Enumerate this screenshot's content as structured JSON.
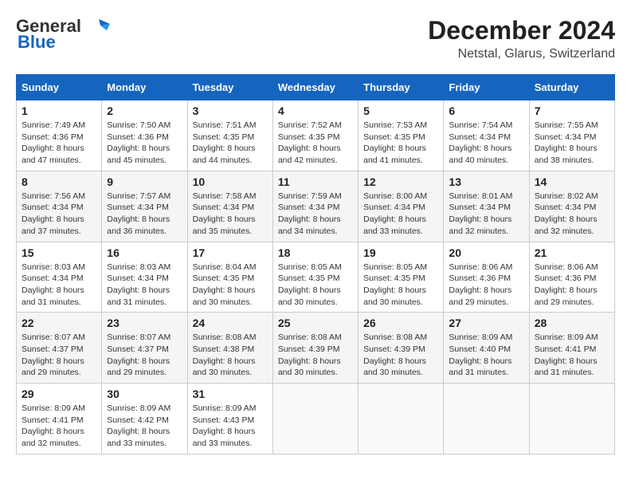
{
  "logo": {
    "line1": "General",
    "line2": "Blue"
  },
  "title": "December 2024",
  "subtitle": "Netstal, Glarus, Switzerland",
  "days_of_week": [
    "Sunday",
    "Monday",
    "Tuesday",
    "Wednesday",
    "Thursday",
    "Friday",
    "Saturday"
  ],
  "weeks": [
    [
      {
        "day": "1",
        "sunrise": "7:49 AM",
        "sunset": "4:36 PM",
        "daylight": "8 hours and 47 minutes."
      },
      {
        "day": "2",
        "sunrise": "7:50 AM",
        "sunset": "4:36 PM",
        "daylight": "8 hours and 45 minutes."
      },
      {
        "day": "3",
        "sunrise": "7:51 AM",
        "sunset": "4:35 PM",
        "daylight": "8 hours and 44 minutes."
      },
      {
        "day": "4",
        "sunrise": "7:52 AM",
        "sunset": "4:35 PM",
        "daylight": "8 hours and 42 minutes."
      },
      {
        "day": "5",
        "sunrise": "7:53 AM",
        "sunset": "4:35 PM",
        "daylight": "8 hours and 41 minutes."
      },
      {
        "day": "6",
        "sunrise": "7:54 AM",
        "sunset": "4:34 PM",
        "daylight": "8 hours and 40 minutes."
      },
      {
        "day": "7",
        "sunrise": "7:55 AM",
        "sunset": "4:34 PM",
        "daylight": "8 hours and 38 minutes."
      }
    ],
    [
      {
        "day": "8",
        "sunrise": "7:56 AM",
        "sunset": "4:34 PM",
        "daylight": "8 hours and 37 minutes."
      },
      {
        "day": "9",
        "sunrise": "7:57 AM",
        "sunset": "4:34 PM",
        "daylight": "8 hours and 36 minutes."
      },
      {
        "day": "10",
        "sunrise": "7:58 AM",
        "sunset": "4:34 PM",
        "daylight": "8 hours and 35 minutes."
      },
      {
        "day": "11",
        "sunrise": "7:59 AM",
        "sunset": "4:34 PM",
        "daylight": "8 hours and 34 minutes."
      },
      {
        "day": "12",
        "sunrise": "8:00 AM",
        "sunset": "4:34 PM",
        "daylight": "8 hours and 33 minutes."
      },
      {
        "day": "13",
        "sunrise": "8:01 AM",
        "sunset": "4:34 PM",
        "daylight": "8 hours and 32 minutes."
      },
      {
        "day": "14",
        "sunrise": "8:02 AM",
        "sunset": "4:34 PM",
        "daylight": "8 hours and 32 minutes."
      }
    ],
    [
      {
        "day": "15",
        "sunrise": "8:03 AM",
        "sunset": "4:34 PM",
        "daylight": "8 hours and 31 minutes."
      },
      {
        "day": "16",
        "sunrise": "8:03 AM",
        "sunset": "4:34 PM",
        "daylight": "8 hours and 31 minutes."
      },
      {
        "day": "17",
        "sunrise": "8:04 AM",
        "sunset": "4:35 PM",
        "daylight": "8 hours and 30 minutes."
      },
      {
        "day": "18",
        "sunrise": "8:05 AM",
        "sunset": "4:35 PM",
        "daylight": "8 hours and 30 minutes."
      },
      {
        "day": "19",
        "sunrise": "8:05 AM",
        "sunset": "4:35 PM",
        "daylight": "8 hours and 30 minutes."
      },
      {
        "day": "20",
        "sunrise": "8:06 AM",
        "sunset": "4:36 PM",
        "daylight": "8 hours and 29 minutes."
      },
      {
        "day": "21",
        "sunrise": "8:06 AM",
        "sunset": "4:36 PM",
        "daylight": "8 hours and 29 minutes."
      }
    ],
    [
      {
        "day": "22",
        "sunrise": "8:07 AM",
        "sunset": "4:37 PM",
        "daylight": "8 hours and 29 minutes."
      },
      {
        "day": "23",
        "sunrise": "8:07 AM",
        "sunset": "4:37 PM",
        "daylight": "8 hours and 29 minutes."
      },
      {
        "day": "24",
        "sunrise": "8:08 AM",
        "sunset": "4:38 PM",
        "daylight": "8 hours and 30 minutes."
      },
      {
        "day": "25",
        "sunrise": "8:08 AM",
        "sunset": "4:39 PM",
        "daylight": "8 hours and 30 minutes."
      },
      {
        "day": "26",
        "sunrise": "8:08 AM",
        "sunset": "4:39 PM",
        "daylight": "8 hours and 30 minutes."
      },
      {
        "day": "27",
        "sunrise": "8:09 AM",
        "sunset": "4:40 PM",
        "daylight": "8 hours and 31 minutes."
      },
      {
        "day": "28",
        "sunrise": "8:09 AM",
        "sunset": "4:41 PM",
        "daylight": "8 hours and 31 minutes."
      }
    ],
    [
      {
        "day": "29",
        "sunrise": "8:09 AM",
        "sunset": "4:41 PM",
        "daylight": "8 hours and 32 minutes."
      },
      {
        "day": "30",
        "sunrise": "8:09 AM",
        "sunset": "4:42 PM",
        "daylight": "8 hours and 33 minutes."
      },
      {
        "day": "31",
        "sunrise": "8:09 AM",
        "sunset": "4:43 PM",
        "daylight": "8 hours and 33 minutes."
      },
      null,
      null,
      null,
      null
    ]
  ]
}
